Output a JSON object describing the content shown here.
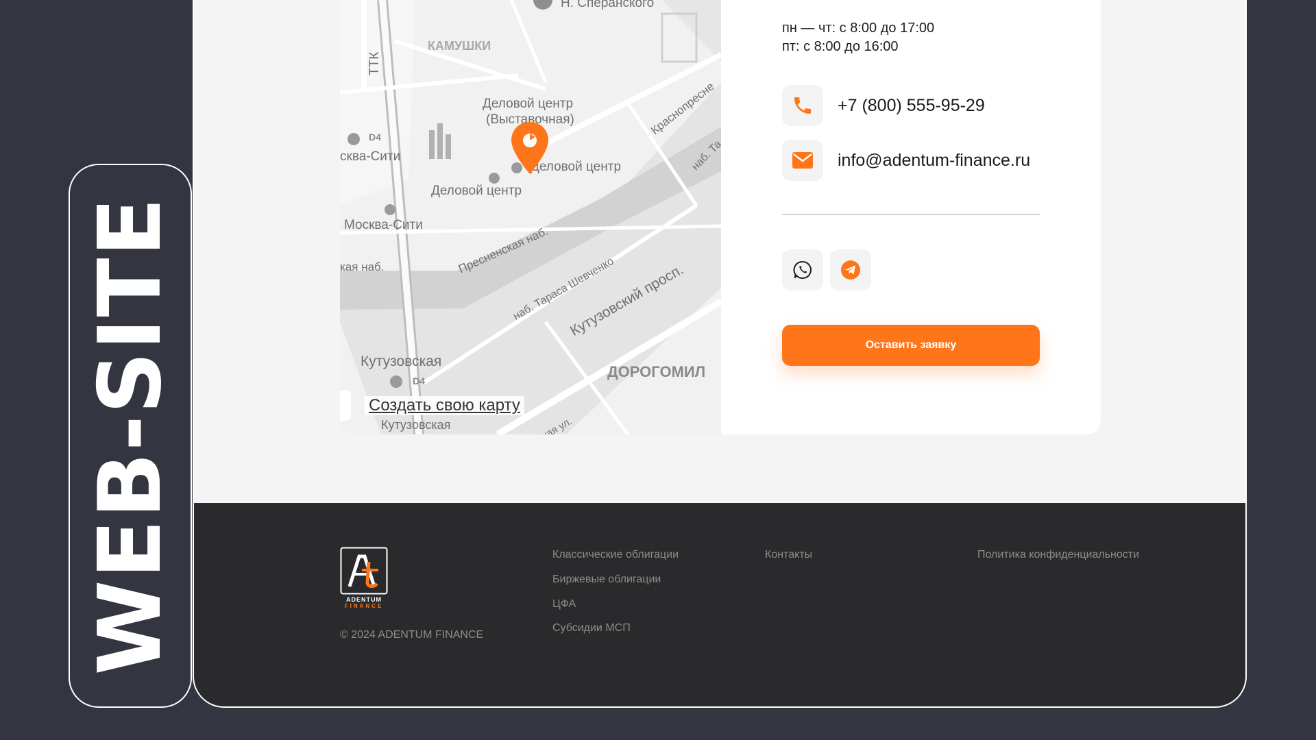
{
  "badge": {
    "text": "WEB-SITE"
  },
  "contacts": {
    "hours": [
      "пн — чт: с 8:00 до 17:00",
      "пт: с 8:00 до 16:00"
    ],
    "phone": "+7 (800) 555-95-29",
    "email": "info@adentum-finance.ru",
    "cta_label": "Оставить заявку"
  },
  "map": {
    "create_link": "Создать свою карту",
    "labels": {
      "speranskogo": "Н. Сперанского",
      "kamushki": "КАМУШКИ",
      "ttk": "ТТК",
      "business_center_1": "Деловой центр",
      "business_center_1b": "(Выставочная)",
      "business_center_2": "Деловой центр",
      "business_center_3": "Деловой центр",
      "moskva_city_1": "сква-Сити",
      "moskva_city_2": "Москва-Сити",
      "krasnopresnenskaya": "Краснопресне",
      "nab_ta": "наб. Та",
      "presnenskaya": "Пресненская наб.",
      "kaya_nab": "кая наб.",
      "nab_tarasa": "наб. Тараса Шевченко",
      "kutuzovsky": "Кутузовский просп.",
      "kutuzovskaya_1": "Кутузовская",
      "kutuzovskaya_2": "Кутузовская",
      "dorogomil": "ДОРОГОМИЛ",
      "kaya_ul": "кая ул.",
      "d4_1": "D4",
      "d4_2": "D4"
    }
  },
  "footer": {
    "logo_lines": [
      "ADENTUM",
      "FINANCE"
    ],
    "copyright": "© 2024 ADENTUM FINANCE",
    "col1": [
      "Классические облигации",
      "Биржевые облигации",
      "ЦФА",
      "Субсидии МСП"
    ],
    "contacts_link": "Контакты",
    "privacy_link": "Политика конфиденциальности"
  },
  "colors": {
    "accent": "#ff761a",
    "background": "#333641",
    "footer": "#2a2a2c"
  },
  "icons": {
    "phone": "phone-icon",
    "email": "mail-icon",
    "whatsapp": "whatsapp-icon",
    "telegram": "telegram-icon",
    "pin": "map-pin-icon"
  }
}
